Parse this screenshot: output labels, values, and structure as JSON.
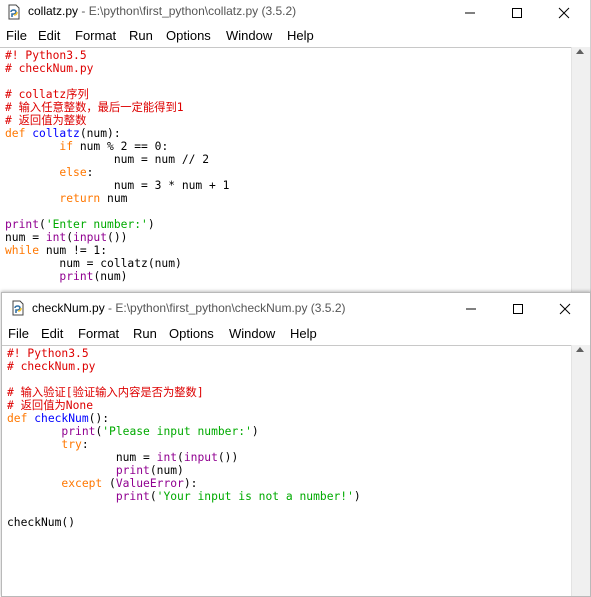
{
  "window1": {
    "title_file": "collatz.py",
    "title_sep": " - ",
    "title_path": "E:\\python\\first_python\\collatz.py",
    "title_version": " (3.5.2)",
    "menu": [
      "File",
      "Edit",
      "Format",
      "Run",
      "Options",
      "Window",
      "Help"
    ],
    "code": [
      [
        [
          "cm",
          "#! Python3.5"
        ]
      ],
      [
        [
          "cm",
          "# checkNum.py"
        ]
      ],
      [],
      [
        [
          "cm",
          "# collatz序列"
        ]
      ],
      [
        [
          "cm",
          "# 输入任意整数，最后一定能得到1"
        ]
      ],
      [
        [
          "cm",
          "# 返回值为整数"
        ]
      ],
      [
        [
          "kw",
          "def "
        ],
        [
          "def",
          "collatz"
        ],
        [
          "",
          "(num):"
        ]
      ],
      [
        [
          "",
          "        "
        ],
        [
          "kw",
          "if"
        ],
        [
          "",
          " num % 2 == 0:"
        ]
      ],
      [
        [
          "",
          "                num = num // 2"
        ]
      ],
      [
        [
          "",
          "        "
        ],
        [
          "kw",
          "else"
        ],
        [
          "",
          ":"
        ]
      ],
      [
        [
          "",
          "                num = 3 * num + 1"
        ]
      ],
      [
        [
          "",
          "        "
        ],
        [
          "kw",
          "return"
        ],
        [
          "",
          " num"
        ]
      ],
      [],
      [
        [
          "bi",
          "print"
        ],
        [
          "",
          "("
        ],
        [
          "str",
          "'Enter number:'"
        ],
        [
          "",
          ")"
        ]
      ],
      [
        [
          "",
          "num = "
        ],
        [
          "bi",
          "int"
        ],
        [
          "",
          "("
        ],
        [
          "bi",
          "input"
        ],
        [
          "",
          "())"
        ]
      ],
      [
        [
          "kw",
          "while"
        ],
        [
          "",
          " num != 1:"
        ]
      ],
      [
        [
          "",
          "        num = collatz(num)"
        ]
      ],
      [
        [
          "",
          "        "
        ],
        [
          "bi",
          "print"
        ],
        [
          "",
          "(num)"
        ]
      ]
    ]
  },
  "window2": {
    "title_file": "checkNum.py",
    "title_sep": " - ",
    "title_path": "E:\\python\\first_python\\checkNum.py",
    "title_version": " (3.5.2)",
    "menu": [
      "File",
      "Edit",
      "Format",
      "Run",
      "Options",
      "Window",
      "Help"
    ],
    "code": [
      [
        [
          "cm",
          "#! Python3.5"
        ]
      ],
      [
        [
          "cm",
          "# checkNum.py"
        ]
      ],
      [],
      [
        [
          "cm",
          "# 输入验证[验证输入内容是否为整数]"
        ]
      ],
      [
        [
          "cm",
          "# 返回值为None"
        ]
      ],
      [
        [
          "kw",
          "def "
        ],
        [
          "def",
          "checkNum"
        ],
        [
          "",
          "():"
        ]
      ],
      [
        [
          "",
          "        "
        ],
        [
          "bi",
          "print"
        ],
        [
          "",
          "("
        ],
        [
          "str",
          "'Please input number:'"
        ],
        [
          "",
          ")"
        ]
      ],
      [
        [
          "",
          "        "
        ],
        [
          "kw",
          "try"
        ],
        [
          "",
          ":"
        ]
      ],
      [
        [
          "",
          "                num = "
        ],
        [
          "bi",
          "int"
        ],
        [
          "",
          "("
        ],
        [
          "bi",
          "input"
        ],
        [
          "",
          "())"
        ]
      ],
      [
        [
          "",
          "                "
        ],
        [
          "bi",
          "print"
        ],
        [
          "",
          "(num)"
        ]
      ],
      [
        [
          "",
          "        "
        ],
        [
          "kw",
          "except"
        ],
        [
          "",
          " ("
        ],
        [
          "bi",
          "ValueError"
        ],
        [
          "",
          "):"
        ]
      ],
      [
        [
          "",
          "                "
        ],
        [
          "bi",
          "print"
        ],
        [
          "",
          "("
        ],
        [
          "str",
          "'Your input is not a number!'"
        ],
        [
          "",
          ")"
        ]
      ],
      [],
      [
        [
          "",
          "checkNum()"
        ]
      ]
    ]
  }
}
